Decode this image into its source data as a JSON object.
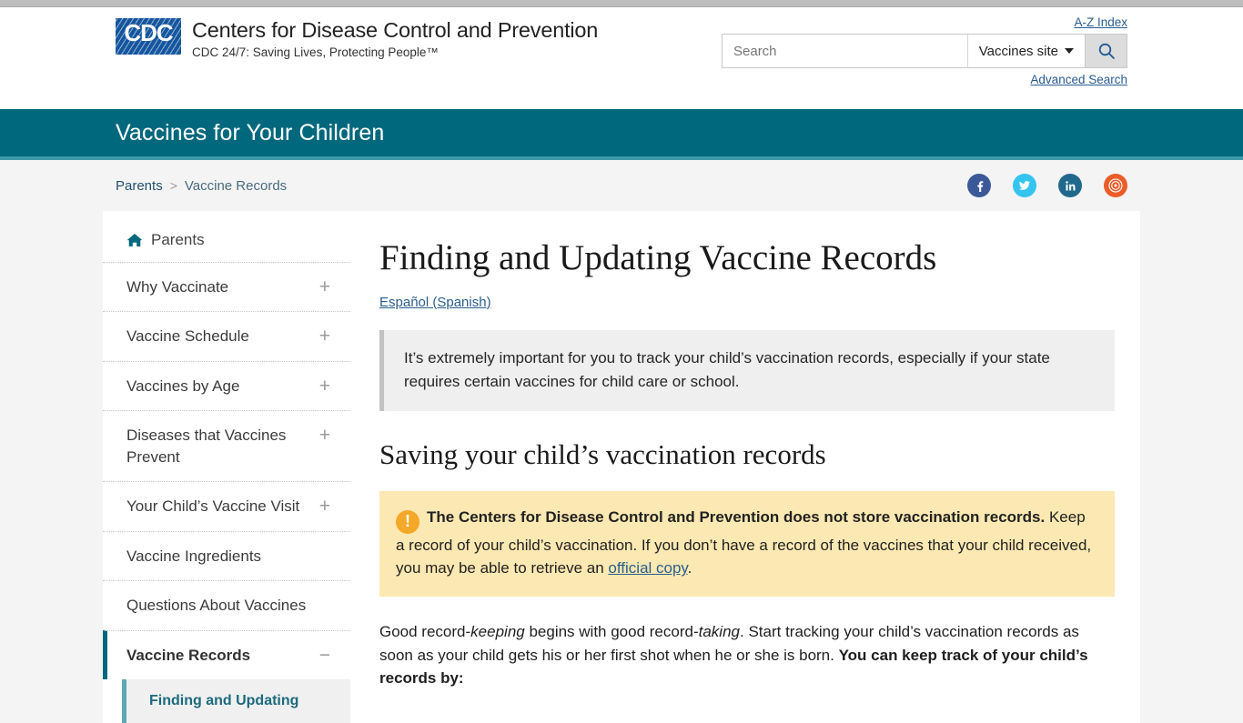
{
  "header": {
    "logo_letters": "CDC",
    "org_title": "Centers for Disease Control and Prevention",
    "tagline": "CDC 24/7: Saving Lives, Protecting People™",
    "az_index": "A-Z Index",
    "advanced_search": "Advanced Search",
    "search_placeholder": "Search",
    "search_value": "",
    "site_scope": "Vaccines site",
    "search_icon": "search-icon",
    "caret_icon": "chevron-down-icon"
  },
  "banner": {
    "title": "Vaccines for Your Children",
    "color": "#00687d"
  },
  "breadcrumb": {
    "parent": "Parents",
    "separator": ">",
    "current": "Vaccine Records"
  },
  "social": [
    {
      "name": "facebook-icon",
      "label": "f",
      "color": "#3b5998"
    },
    {
      "name": "twitter-icon",
      "label": "ᵛ",
      "color": "#35c4f0"
    },
    {
      "name": "linkedin-icon",
      "label": "in",
      "color": "#21698c"
    },
    {
      "name": "syndicate-icon",
      "label": "◉",
      "color": "#ec5c29"
    }
  ],
  "sidebar": {
    "home_label": "Parents",
    "home_icon": "home-icon",
    "items": [
      {
        "label": "Why Vaccinate",
        "expander": "+"
      },
      {
        "label": "Vaccine Schedule",
        "expander": "+"
      },
      {
        "label": "Vaccines by Age",
        "expander": "+"
      },
      {
        "label": "Diseases that Vaccines Prevent",
        "expander": "+"
      },
      {
        "label": "Your Child’s Vaccine Visit",
        "expander": "+"
      },
      {
        "label": "Vaccine Ingredients",
        "expander": ""
      },
      {
        "label": "Questions About Vaccines",
        "expander": ""
      },
      {
        "label": "Vaccine Records",
        "expander": "−",
        "active": true
      }
    ],
    "subitem": "Finding and Updating"
  },
  "main": {
    "title": "Finding and Updating Vaccine Records",
    "spanish_link": "Español (Spanish)",
    "gray_callout": "It’s extremely important for you to track your child’s vaccination records, especially if your state requires certain vaccines for child care or school.",
    "section_title": "Saving your child’s vaccination records",
    "warning": {
      "icon": "alert-exclamation-icon",
      "bold_text": "The Centers for Disease Control and Prevention does not store vaccination records.",
      "text_part1": " Keep a record of your child’s vaccination. If you don’t have a record of the vaccines that your child received, you may be able to retrieve an ",
      "link_text": "official copy",
      "text_part2": "."
    },
    "paragraph": {
      "p1": "Good record-",
      "em1": "keeping",
      "p2": " begins with good record-",
      "em2": "taking",
      "p3": ".  Start tracking your child’s vaccination records as soon as your child gets his or her first shot when he or she is born. ",
      "strong1": "You can keep track of your child’s records by:"
    }
  }
}
